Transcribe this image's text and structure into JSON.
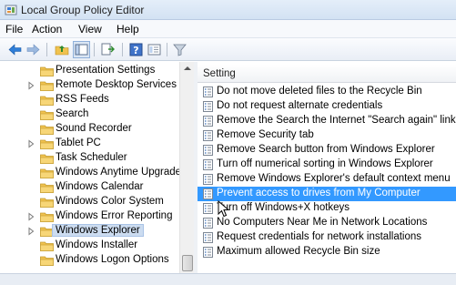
{
  "window": {
    "title": "Local Group Policy Editor"
  },
  "menu": [
    "File",
    "Action",
    "View",
    "Help"
  ],
  "toolbar": {
    "buttons": [
      "back-icon",
      "forward-icon",
      "up-folder-icon",
      "show-hide-tree-icon",
      "export-list-icon",
      "help-icon",
      "properties-icon",
      "filter-icon"
    ]
  },
  "tree": {
    "items": [
      {
        "label": "Presentation Settings",
        "expandable": false
      },
      {
        "label": "Remote Desktop Services",
        "expandable": true
      },
      {
        "label": "RSS Feeds",
        "expandable": false
      },
      {
        "label": "Search",
        "expandable": false
      },
      {
        "label": "Sound Recorder",
        "expandable": false
      },
      {
        "label": "Tablet PC",
        "expandable": true
      },
      {
        "label": "Task Scheduler",
        "expandable": false
      },
      {
        "label": "Windows Anytime Upgrade",
        "expandable": false
      },
      {
        "label": "Windows Calendar",
        "expandable": false
      },
      {
        "label": "Windows Color System",
        "expandable": false
      },
      {
        "label": "Windows Error Reporting",
        "expandable": true
      },
      {
        "label": "Windows Explorer",
        "expandable": true,
        "selected": true
      },
      {
        "label": "Windows Installer",
        "expandable": false
      },
      {
        "label": "Windows Logon Options",
        "expandable": false
      }
    ]
  },
  "settings": {
    "column_header": "Setting",
    "items": [
      {
        "label": "Do not move deleted files to the Recycle Bin"
      },
      {
        "label": "Do not request alternate credentials"
      },
      {
        "label": "Remove the Search the Internet \"Search again\" link"
      },
      {
        "label": "Remove Security tab"
      },
      {
        "label": "Remove Search button from Windows Explorer"
      },
      {
        "label": "Turn off numerical sorting in Windows Explorer"
      },
      {
        "label": "Remove Windows Explorer's default context menu"
      },
      {
        "label": "Prevent access to drives from My Computer",
        "selected": true
      },
      {
        "label": "Turn off Windows+X hotkeys"
      },
      {
        "label": "No Computers Near Me in Network Locations"
      },
      {
        "label": "Request credentials for network installations"
      },
      {
        "label": "Maximum allowed Recycle Bin size"
      }
    ]
  },
  "colors": {
    "selection": "#3399ff",
    "tree_selection": "#ccdcf0",
    "folder": "#f0c24f"
  }
}
